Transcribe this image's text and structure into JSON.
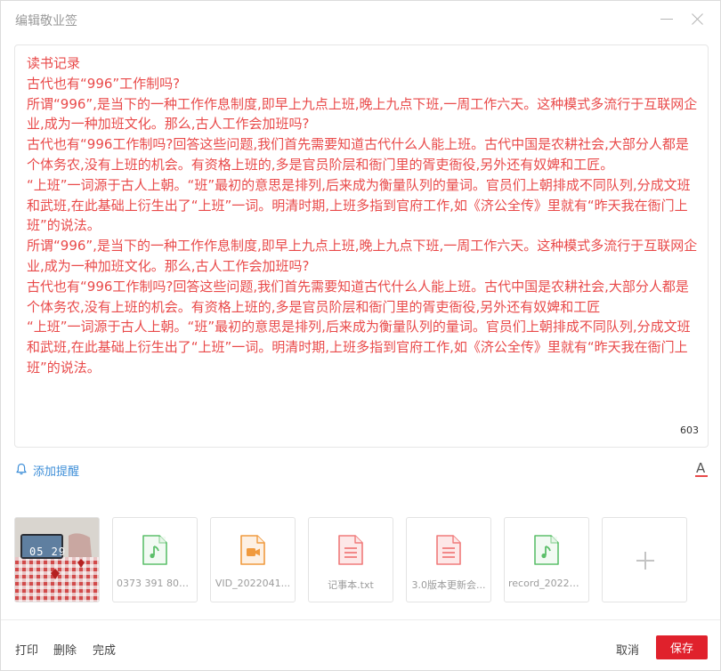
{
  "window": {
    "title": "编辑敬业签"
  },
  "editor": {
    "paragraphs": [
      "读书记录",
      "古代也有“996”工作制吗?",
      "所谓“996”,是当下的一种工作作息制度,即早上九点上班,晚上九点下班,一周工作六天。这种模式多流行于互联网企业,成为一种加班文化。那么,古人工作会加班吗?",
      "古代也有“996工作制吗?回答这些问题,我们首先需要知道古代什么人能上班。古代中国是农耕社会,大部分人都是个体务农,没有上班的机会。有资格上班的,多是官员阶层和衙门里的胥吏衙役,另外还有奴婢和工匠。",
      "“上班”一词源于古人上朝。“班”最初的意思是排列,后来成为衡量队列的量词。官员们上朝排成不同队列,分成文班和武班,在此基础上衍生出了“上班”一词。明清时期,上班多指到官府工作,如《济公全传》里就有“昨天我在衙门上班”的说法。",
      "所谓“996”,是当下的一种工作作息制度,即早上九点上班,晚上九点下班,一周工作六天。这种模式多流行于互联网企业,成为一种加班文化。那么,古人工作会加班吗?",
      "古代也有“996工作制吗?回答这些问题,我们首先需要知道古代什么人能上班。古代中国是农耕社会,大部分人都是个体务农,没有上班的机会。有资格上班的,多是官员阶层和衙门里的胥吏衙役,另外还有奴婢和工匠",
      "“上班”一词源于古人上朝。“班”最初的意思是排列,后来成为衡量队列的量词。官员们上朝排成不同队列,分成文班和武班,在此基础上衍生出了“上班”一词。明清时期,上班多指到官府工作,如《济公全传》里就有“昨天我在衙门上班”的说法。"
    ],
    "char_count": "603",
    "text_color": "#e94a4a"
  },
  "reminder": {
    "label": "添加提醒"
  },
  "attachments": {
    "photo_time": "05 29",
    "items": [
      {
        "name": "0373 391 802...",
        "icon": "audio-file-icon",
        "color": "#5cbf6a"
      },
      {
        "name": "VID_2022041...",
        "icon": "video-file-icon",
        "color": "#f09a3e"
      },
      {
        "name": "记事本.txt",
        "icon": "text-file-icon",
        "color": "#f07a7a"
      },
      {
        "name": "3.0版本更新会...",
        "icon": "text-file-icon",
        "color": "#f07a7a"
      },
      {
        "name": "record_20220...",
        "icon": "audio-file-icon",
        "color": "#5cbf6a"
      }
    ]
  },
  "footer": {
    "print": "打印",
    "delete": "删除",
    "done": "完成",
    "cancel": "取消",
    "save": "保存"
  },
  "colors": {
    "accent": "#e0212c",
    "link": "#3f8fd8"
  }
}
